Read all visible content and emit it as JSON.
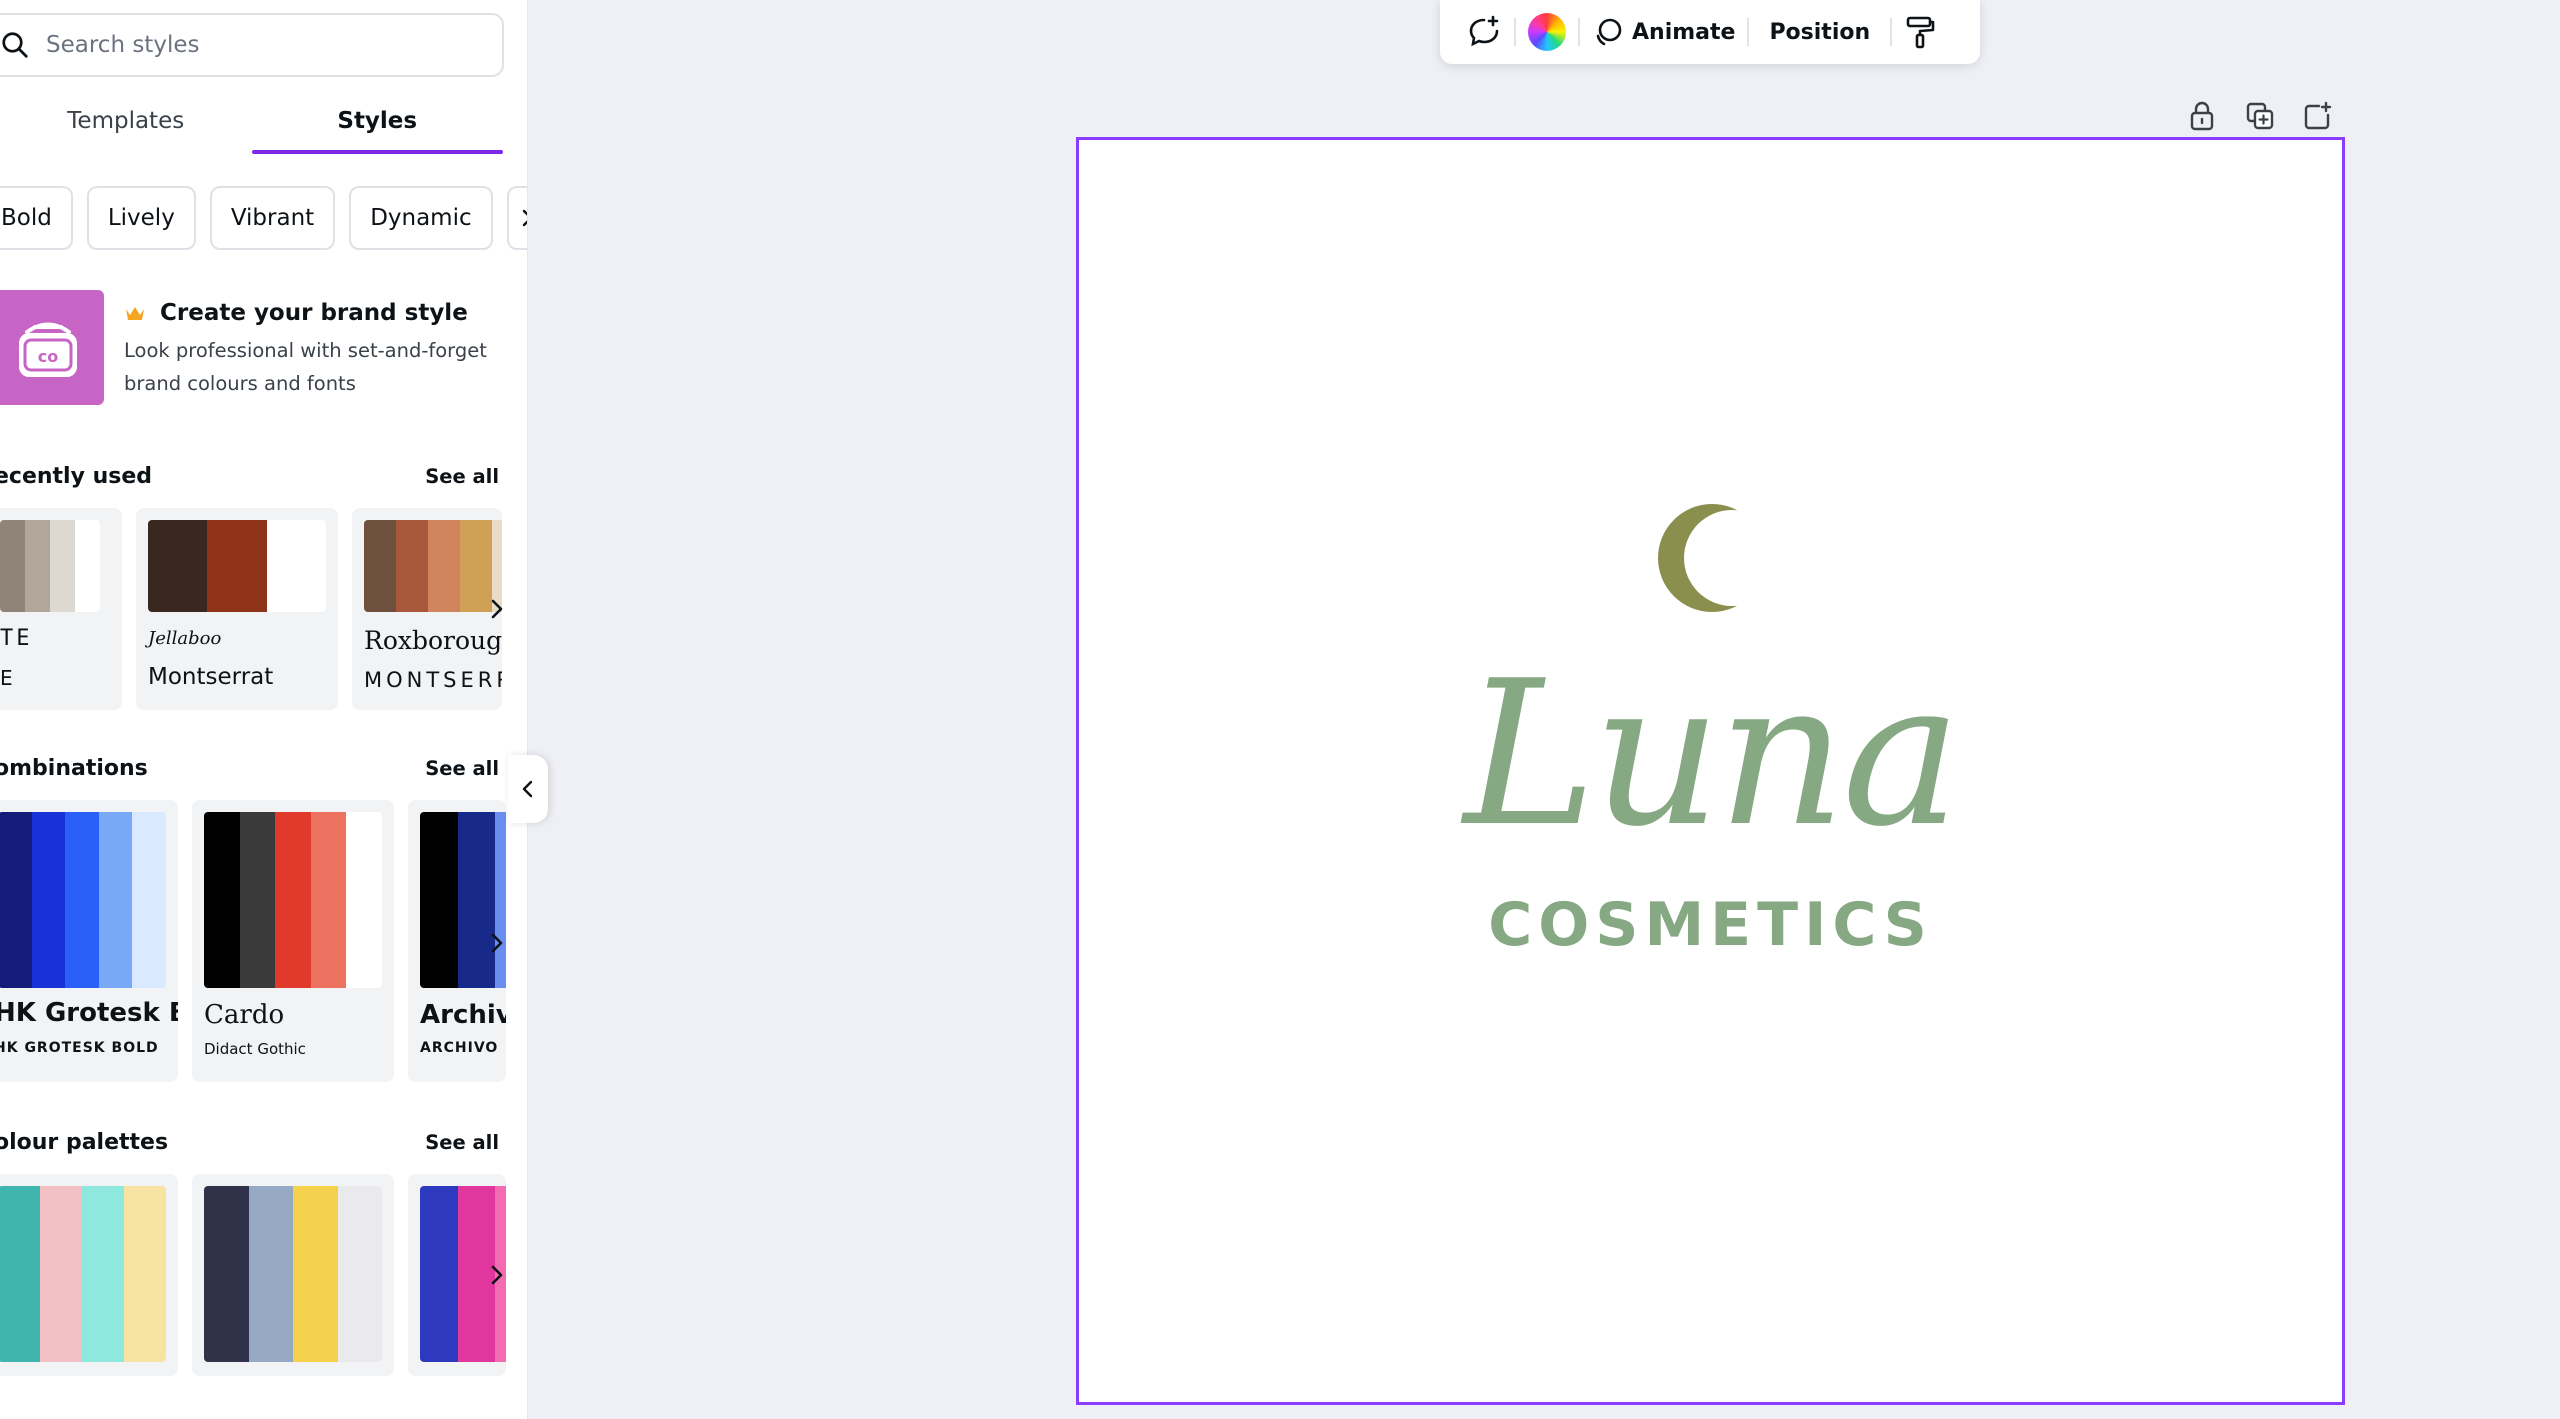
{
  "sidebar": {
    "search": {
      "placeholder": "Search styles"
    },
    "tabs": [
      {
        "label": "Templates"
      },
      {
        "label": "Styles"
      }
    ],
    "chips": [
      "Bold",
      "Lively",
      "Vibrant",
      "Dynamic"
    ],
    "promo": {
      "title": "Create your brand style",
      "description": "Look professional with set-and-forget brand colours and fonts",
      "tile_text": "co",
      "tile_color": "#c765c6"
    },
    "recently_used": {
      "title": "ecently used",
      "see_all": "See all",
      "cards": [
        {
          "font_a": "TE",
          "font_b": "E",
          "colors": [
            "#8f8477",
            "#b1a699",
            "#ded8d2",
            "#ffffff"
          ]
        },
        {
          "font_a": "Jellaboo",
          "font_b": "Montserrat",
          "colors": [
            "#3a2820",
            "#8e3218",
            "#ffffff"
          ]
        },
        {
          "font_a": "Roxborough",
          "font_b": "MONTSERRAT",
          "colors": [
            "#6f4f3d",
            "#a9573a",
            "#cf845b",
            "#d0a056",
            "#e9dcc8"
          ]
        }
      ]
    },
    "combinations": {
      "title": "ombinations",
      "see_all": "See all",
      "cards": [
        {
          "font_a": "HK Grotesk Bold",
          "font_b": "HK GROTESK BOLD",
          "colors": [
            "#141b7a",
            "#1832d8",
            "#2a60f7",
            "#78a9f7",
            "#d9e9ff"
          ]
        },
        {
          "font_a": "Cardo",
          "font_b": "Didact Gothic",
          "colors": [
            "#000000",
            "#3a3a3a",
            "#e03a2d",
            "#ed7360",
            "#ffffff"
          ]
        },
        {
          "font_a": "Archivo",
          "font_b": "ARCHIVO",
          "colors": [
            "#000000",
            "#172a8a",
            "#6a8ef0",
            "#cddaff"
          ]
        }
      ]
    },
    "colour_palettes": {
      "title": "olour palettes",
      "see_all": "See all",
      "cards": [
        {
          "colors": [
            "#3fb6ad",
            "#f1bfc4",
            "#8ee8de",
            "#f7e4a2"
          ]
        },
        {
          "colors": [
            "#2f3249",
            "#96aac6",
            "#f5d24d",
            "#eaeaec"
          ]
        },
        {
          "colors": [
            "#2d39bf",
            "#e2369f",
            "#f36bb1",
            "#f9c5bf"
          ]
        }
      ]
    }
  },
  "toolbar": {
    "animate_label": "Animate",
    "position_label": "Position"
  },
  "canvas": {
    "brand_name": "Luna",
    "brand_sub": "COSMETICS",
    "text_color": "#86a883",
    "moon_color": "#8a8f4e",
    "selection_color": "#8b3dff"
  }
}
